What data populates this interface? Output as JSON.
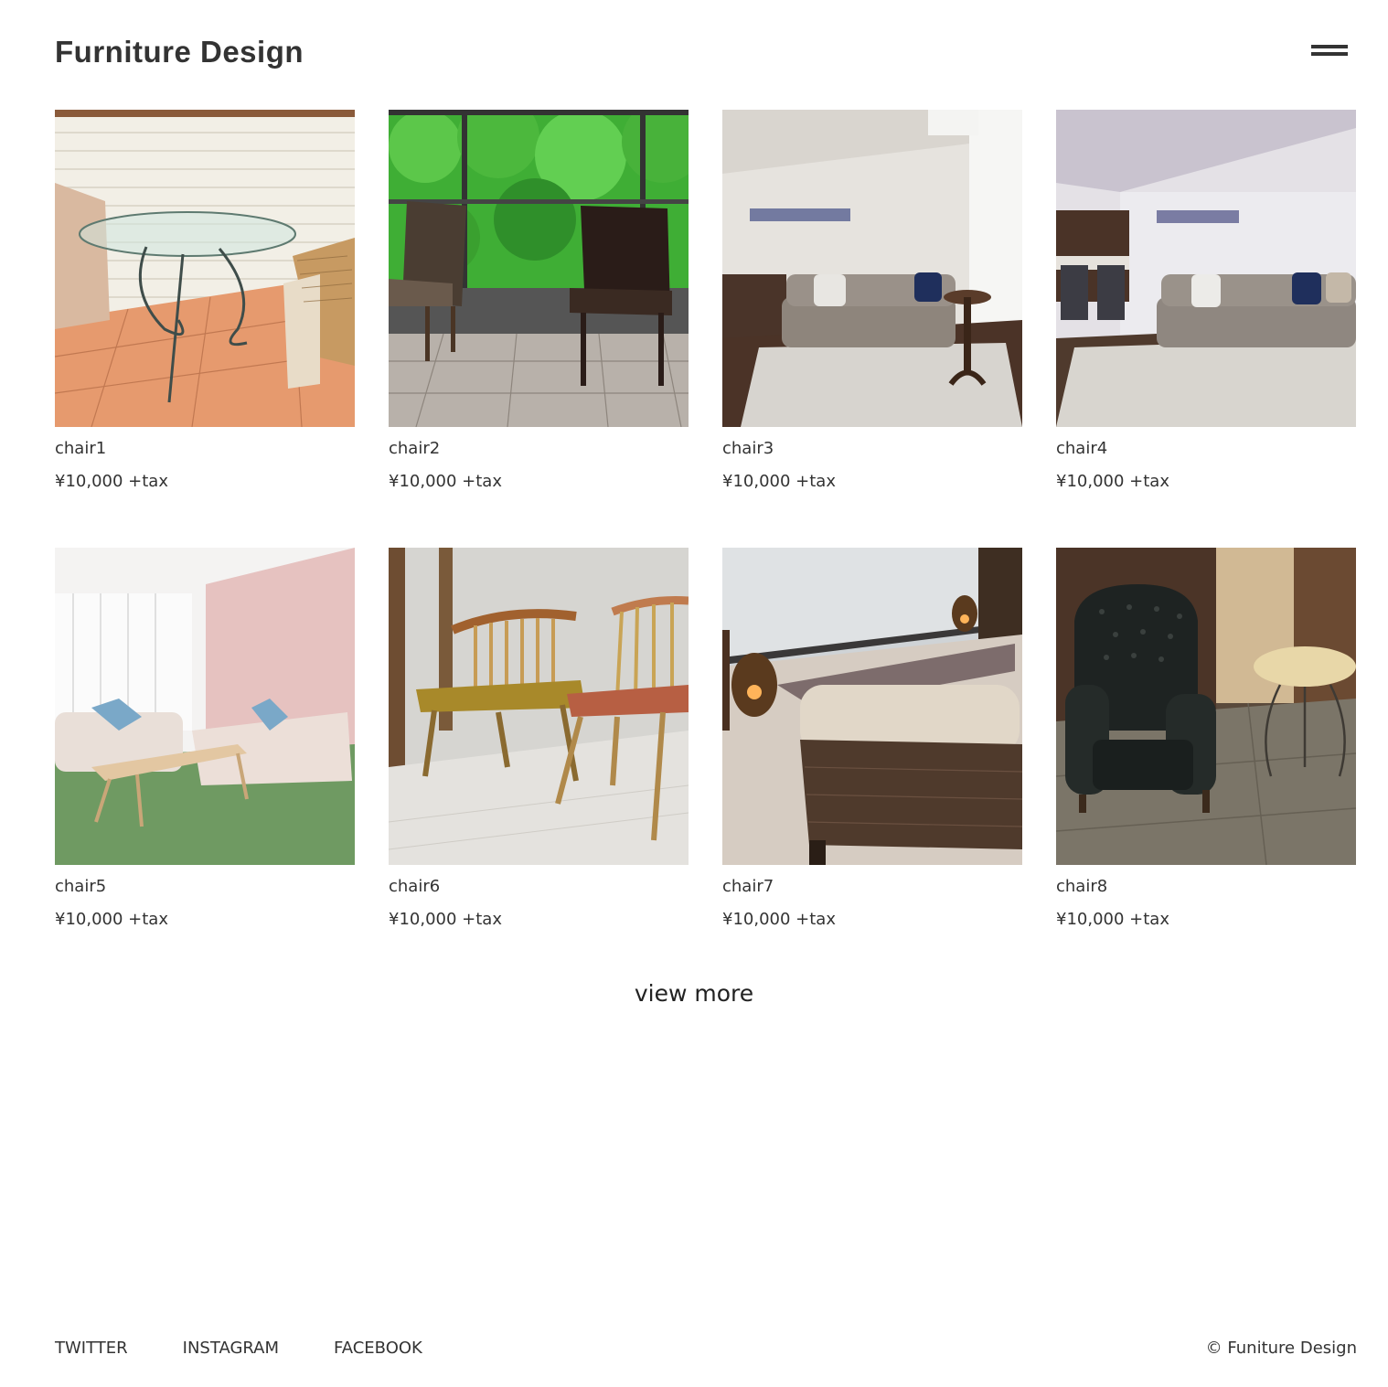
{
  "header": {
    "logo": "Furniture Design",
    "menu_icon": "hamburger-menu-icon"
  },
  "products": [
    {
      "name": "chair1",
      "price": "¥10,000 +tax",
      "image": "patio-glass-table-wicker-chairs-photo"
    },
    {
      "name": "chair2",
      "price": "¥10,000 +tax",
      "image": "dining-chairs-forest-window-photo"
    },
    {
      "name": "chair3",
      "price": "¥10,000 +tax",
      "image": "living-room-grey-sofa-photo"
    },
    {
      "name": "chair4",
      "price": "¥10,000 +tax",
      "image": "living-room-sofa-kitchen-photo"
    },
    {
      "name": "chair5",
      "price": "¥10,000 +tax",
      "image": "pink-room-sofa-coffee-table-photo"
    },
    {
      "name": "chair6",
      "price": "¥10,000 +tax",
      "image": "wooden-windsor-bench-chair-photo"
    },
    {
      "name": "chair7",
      "price": "¥10,000 +tax",
      "image": "ottoman-lantern-room-photo"
    },
    {
      "name": "chair8",
      "price": "¥10,000 +tax",
      "image": "leather-armchair-side-table-photo"
    }
  ],
  "view_more": "view more",
  "footer": {
    "links": [
      "TWITTER",
      "INSTAGRAM",
      "FACEBOOK"
    ],
    "copyright": "© Funiture Design"
  }
}
